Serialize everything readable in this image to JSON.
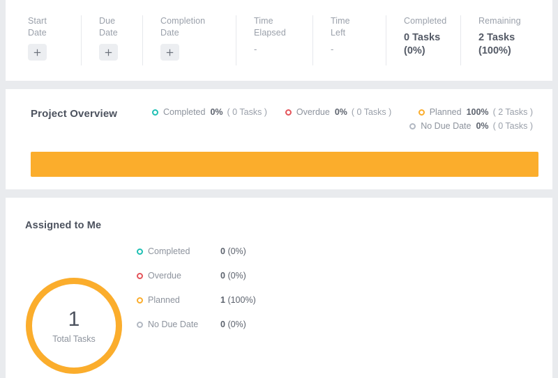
{
  "colors": {
    "completed": "#1fc0b4",
    "overdue": "#e4545a",
    "planned": "#fbad2c",
    "no_due_date": "#b2b8c2",
    "bar_fill": "#fbad2c",
    "page_bg": "#e9ebee",
    "card_bg": "#ffffff"
  },
  "meta_strip": {
    "columns": [
      {
        "label": "Start\nDate",
        "type": "plus",
        "value": "",
        "icon": "plus-icon"
      },
      {
        "label": "Due\nDate",
        "type": "plus",
        "value": "",
        "icon": "plus-icon"
      },
      {
        "label": "Completion\nDate",
        "type": "plus",
        "value": "",
        "icon": "plus-icon"
      },
      {
        "label": "Time\nElapsed",
        "type": "dash",
        "value": "-"
      },
      {
        "label": "Time\nLeft",
        "type": "dash",
        "value": "-"
      },
      {
        "label": "Completed",
        "type": "stat",
        "value": "0 Tasks",
        "value2": "(0%)"
      },
      {
        "label": "Remaining",
        "type": "stat",
        "value": "2 Tasks",
        "value2": "(100%)"
      }
    ]
  },
  "overview": {
    "title": "Project Overview",
    "legend": [
      {
        "label": "Completed",
        "pct": "0%",
        "count": "( 0 Tasks )",
        "color": "#1fc0b4"
      },
      {
        "label": "Overdue",
        "pct": "0%",
        "count": "( 0 Tasks )",
        "color": "#e4545a"
      },
      {
        "label": "Planned",
        "pct": "100%",
        "count": "( 2 Tasks )",
        "color": "#fbad2c"
      },
      {
        "label": "No Due Date",
        "pct": "0%",
        "count": "( 0 Tasks )",
        "color": "#b2b8c2"
      }
    ],
    "progress_percent": 100
  },
  "assigned": {
    "title": "Assigned to Me",
    "donut": {
      "total": "1",
      "caption": "Total Tasks",
      "ring_color": "#fbad2c",
      "filled_percent": 100
    },
    "rows": [
      {
        "label": "Completed",
        "count": "0",
        "pct": "(0%)",
        "color": "#1fc0b4"
      },
      {
        "label": "Overdue",
        "count": "0",
        "pct": "(0%)",
        "color": "#e4545a"
      },
      {
        "label": "Planned",
        "count": "1",
        "pct": "(100%)",
        "color": "#fbad2c"
      },
      {
        "label": "No Due Date",
        "count": "0",
        "pct": "(0%)",
        "color": "#b2b8c2"
      }
    ]
  },
  "chart_data": [
    {
      "type": "bar",
      "title": "Project Overview",
      "orientation": "horizontal-stacked",
      "categories": [
        "Completed",
        "Overdue",
        "Planned",
        "No Due Date"
      ],
      "values": [
        0,
        0,
        100,
        0
      ],
      "counts": [
        0,
        0,
        2,
        0
      ],
      "unit": "%",
      "total_tasks": 2,
      "colors": [
        "#1fc0b4",
        "#e4545a",
        "#fbad2c",
        "#b2b8c2"
      ],
      "legend_position": "top-right",
      "grid": false
    },
    {
      "type": "pie",
      "title": "Assigned to Me",
      "subtype": "donut",
      "center_label": "1",
      "center_sublabel": "Total Tasks",
      "categories": [
        "Completed",
        "Overdue",
        "Planned",
        "No Due Date"
      ],
      "values": [
        0,
        0,
        100,
        0
      ],
      "counts": [
        0,
        0,
        1,
        0
      ],
      "unit": "%",
      "colors": [
        "#1fc0b4",
        "#e4545a",
        "#fbad2c",
        "#b2b8c2"
      ],
      "legend_position": "right"
    }
  ]
}
